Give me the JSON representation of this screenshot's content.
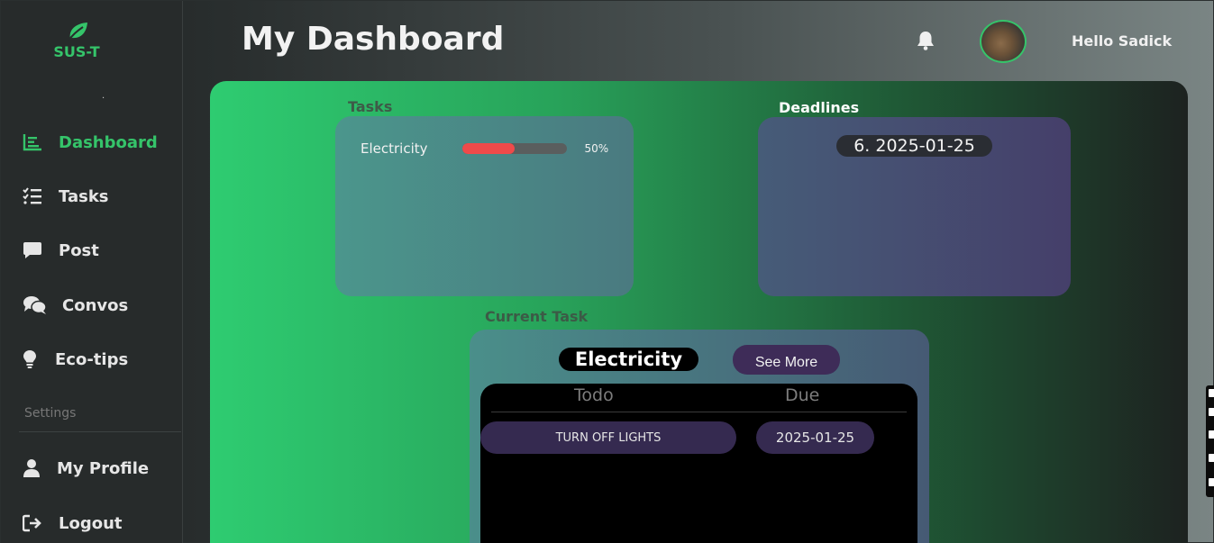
{
  "brand": {
    "name": "SUS-T",
    "logo_icon": "leaf-icon",
    "dot": "."
  },
  "sidebar": {
    "items": [
      {
        "label": "Dashboard",
        "icon": "chart-icon",
        "active": true
      },
      {
        "label": "Tasks",
        "icon": "tasks-list-icon",
        "active": false
      },
      {
        "label": "Post",
        "icon": "comment-icon",
        "active": false
      },
      {
        "label": "Convos",
        "icon": "comments-icon",
        "active": false
      },
      {
        "label": "Eco-tips",
        "icon": "lightbulb-icon",
        "active": false
      }
    ],
    "settings_label": "Settings",
    "settings_items": [
      {
        "label": "My Profile",
        "icon": "user-icon"
      },
      {
        "label": "Logout",
        "icon": "logout-icon"
      }
    ]
  },
  "header": {
    "title": "My Dashboard",
    "greeting": "Hello Sadick",
    "bell_icon": "bell-icon"
  },
  "main": {
    "tasks_label": "Tasks",
    "tasks": [
      {
        "name": "Electricity",
        "progress_percent": 50,
        "progress_text": "50%"
      }
    ],
    "deadlines_label": "Deadlines",
    "deadlines": [
      "6. 2025-01-25"
    ],
    "current_task_label": "Current Task",
    "current_task": {
      "name": "Electricity",
      "see_more_label": "See More",
      "columns": {
        "todo": "Todo",
        "due": "Due"
      },
      "rows": [
        {
          "todo": "TURN OFF LIGHTS",
          "due": "2025-01-25"
        }
      ]
    }
  },
  "colors": {
    "accent": "#35c46a",
    "progress_fill": "#ef4a4a",
    "pill_purple": "#352a50"
  }
}
